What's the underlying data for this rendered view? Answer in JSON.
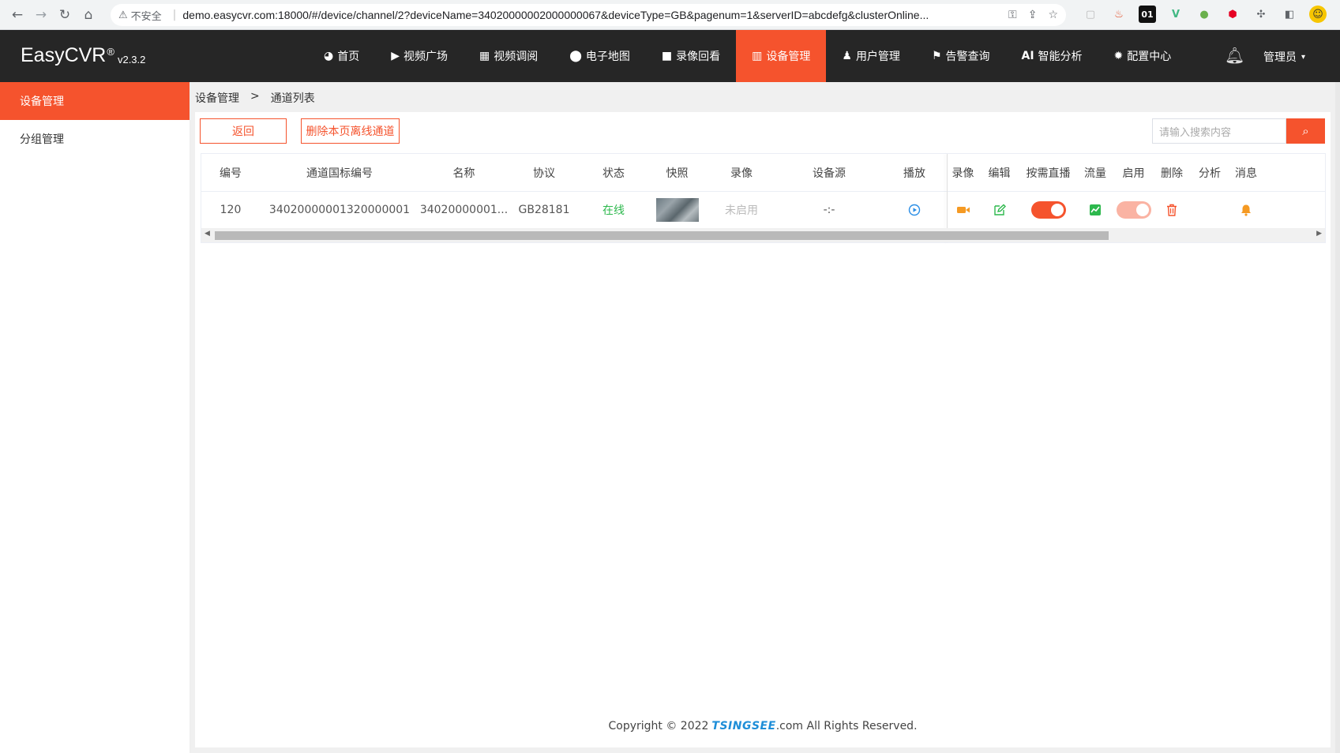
{
  "browser": {
    "security_label": "不安全",
    "url": "demo.easycvr.com:18000/#/device/channel/2?deviceName=34020000002000000067&deviceType=GB&pagenum=1&serverID=abcdefg&clusterOnline..."
  },
  "app": {
    "logo": "EasyCVR",
    "logo_mark": "®",
    "version": "v2.3.2"
  },
  "menu": [
    {
      "label": "首页",
      "icon": "dashboard-icon"
    },
    {
      "label": "视频广场",
      "icon": "play-circle-icon"
    },
    {
      "label": "视频调阅",
      "icon": "grid-icon"
    },
    {
      "label": "电子地图",
      "icon": "map-pin-icon"
    },
    {
      "label": "录像回看",
      "icon": "video-camera-icon"
    },
    {
      "label": "设备管理",
      "icon": "device-icon",
      "active": true
    },
    {
      "label": "用户管理",
      "icon": "user-icon"
    },
    {
      "label": "告警查询",
      "icon": "alarm-icon"
    },
    {
      "label": "智能分析",
      "icon": "ai-icon",
      "icon_text": "AI"
    },
    {
      "label": "配置中心",
      "icon": "gear-icon"
    }
  ],
  "user": {
    "label": "管理员"
  },
  "sidebar": {
    "items": [
      {
        "label": "设备管理",
        "active": true
      },
      {
        "label": "分组管理"
      }
    ]
  },
  "breadcrumb": {
    "root": "设备管理",
    "sep": ">",
    "current": "通道列表"
  },
  "toolbar": {
    "back_label": "返回",
    "delete_offline_label": "删除本页离线通道",
    "search_placeholder": "请输入搜索内容"
  },
  "table": {
    "columns": [
      "编号",
      "通道国标编号",
      "名称",
      "协议",
      "状态",
      "快照",
      "录像",
      "设备源",
      "播放",
      "录像",
      "编辑",
      "按需直播",
      "流量",
      "启用",
      "删除",
      "分析",
      "消息"
    ],
    "rows": [
      {
        "id": "120",
        "channel_code": "34020000001320000001",
        "name": "34020000001...",
        "protocol": "GB28181",
        "status": "在线",
        "record": "未启用",
        "source": "-:-",
        "on_demand": true,
        "enabled": true
      }
    ]
  },
  "footer": {
    "prefix": "Copyright © 2022",
    "brand": "TSINGSEE",
    "suffix": ".com All Rights Reserved."
  },
  "colors": {
    "accent": "#f5532d",
    "topbar": "#262626",
    "online": "#2db84d"
  }
}
